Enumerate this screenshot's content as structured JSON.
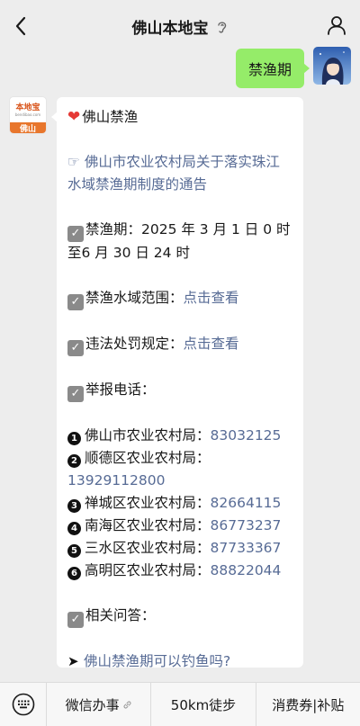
{
  "header": {
    "title": "佛山本地宝"
  },
  "outgoing": {
    "text": "禁渔期"
  },
  "incoming_avatar": {
    "brand": "本地宝",
    "url": "bendibao.com",
    "city": "佛山"
  },
  "message": {
    "heading": "佛山禁渔",
    "notice_link_line1": "☞ 佛山市农业农村局关于落实珠江",
    "notice_link_line2": "水域禁渔期制度的通告",
    "period_line1": "禁渔期：2025 年 3 月 1 日 0 时",
    "period_line2": "至6 月 30 日 24 时",
    "scope_label": "禁渔水域范围：",
    "scope_link": "点击查看",
    "penalty_label": "违法处罚规定：",
    "penalty_link": "点击查看",
    "report_label": "举报电话：",
    "contacts": [
      {
        "num": "1",
        "name": "佛山市农业农村局：",
        "phone": "83032125"
      },
      {
        "num": "2",
        "name": "顺德区农业农村局：",
        "phone": "13929112800"
      },
      {
        "num": "3",
        "name": "禅城区农业农村局：",
        "phone": "82664115"
      },
      {
        "num": "4",
        "name": "南海区农业农村局：",
        "phone": "86773237"
      },
      {
        "num": "5",
        "name": "三水区农业农村局：",
        "phone": "87733367"
      },
      {
        "num": "6",
        "name": "高明区农业农村局：",
        "phone": "88822044"
      }
    ],
    "faq_label": "相关问答：",
    "faq_link": "佛山禁渔期可以钓鱼吗?"
  },
  "bottom_menu": {
    "item1": "微信办事",
    "item2": "50km徒步",
    "item3": "消费券|补贴"
  }
}
